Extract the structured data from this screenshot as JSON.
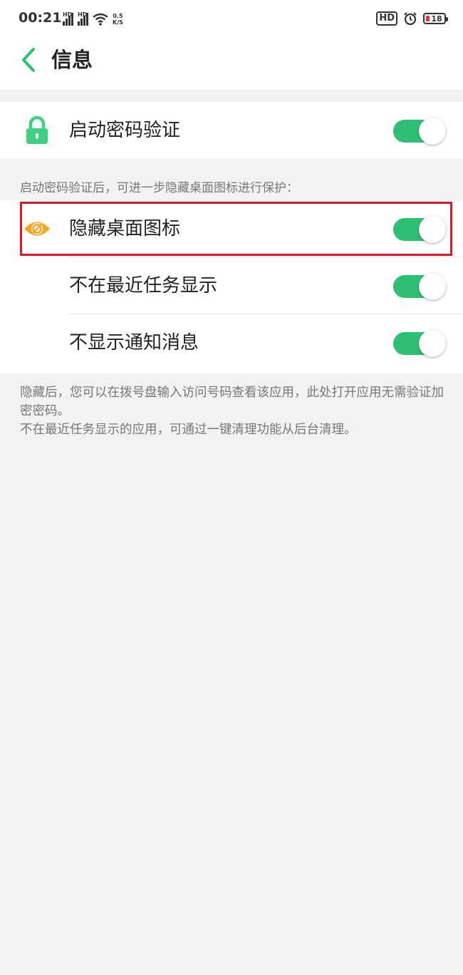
{
  "status_bar": {
    "time": "00:21",
    "signal1_label": "HD",
    "signal2_label": "HD",
    "net_speed_value": "0.5",
    "net_speed_unit": "K/S",
    "hd_badge": "HD",
    "battery_level": "18",
    "battery_color": "#e23a3a"
  },
  "header": {
    "title": "信息"
  },
  "password_section": {
    "label": "启动密码验证",
    "enabled": true,
    "icon": "lock-icon"
  },
  "section_note": "启动密码验证后，可进一步隐藏桌面图标进行保护：",
  "options": [
    {
      "label": "隐藏桌面图标",
      "enabled": true,
      "icon": "hidden-eye-icon"
    },
    {
      "label": "不在最近任务显示",
      "enabled": true
    },
    {
      "label": "不显示通知消息",
      "enabled": true
    }
  ],
  "footer_note": {
    "line1": "隐藏后，您可以在拨号盘输入访问号码查看该应用，此处打开应用无需验证加密密码。",
    "line2": "不在最近任务显示的应用，可通过一键清理功能从后台清理。"
  },
  "colors": {
    "accent": "#2fbf73",
    "icon_orange": "#f6a623",
    "highlight": "#e0182d"
  }
}
